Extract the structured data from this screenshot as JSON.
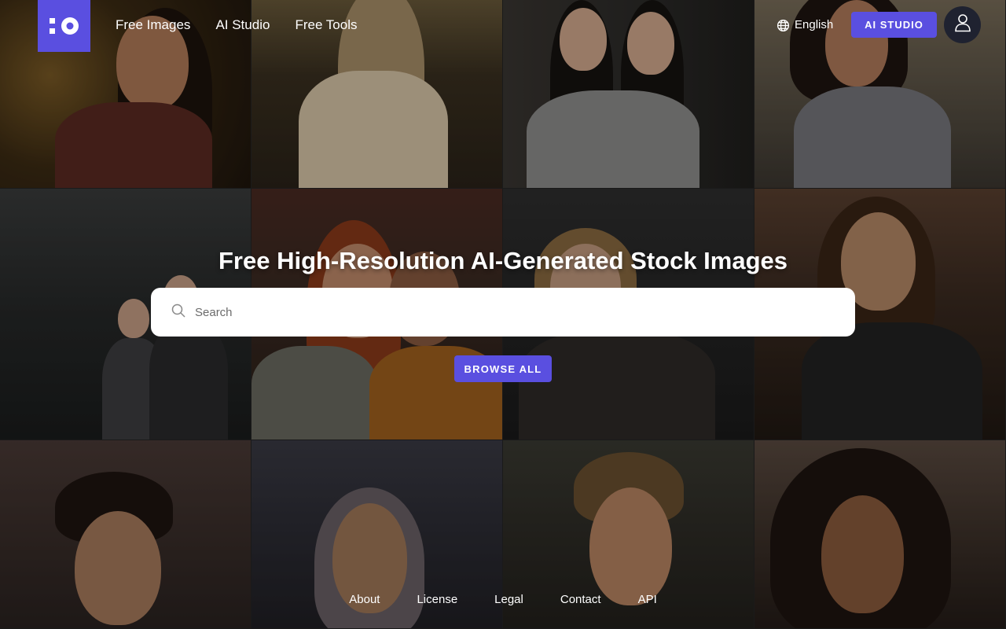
{
  "header": {
    "logo_alt": "",
    "nav": [
      "Free Images",
      "AI Studio",
      "Free Tools"
    ],
    "language": "English",
    "studio_button": "AI STUDIO"
  },
  "hero": {
    "title": "Free High-Resolution AI-Generated Stock Images",
    "search_placeholder": "Search",
    "browse_button": "BROWSE ALL"
  },
  "footer": {
    "links": [
      "About",
      "License",
      "Legal",
      "Contact",
      "API"
    ]
  },
  "icons": {
    "logo": "logo-icon",
    "language": "globe-icon",
    "account": "user-icon",
    "search": "search-icon"
  },
  "colors": {
    "accent": "#5a4fe0",
    "account_button": "#1f2230",
    "search_bg": "#ffffff"
  }
}
